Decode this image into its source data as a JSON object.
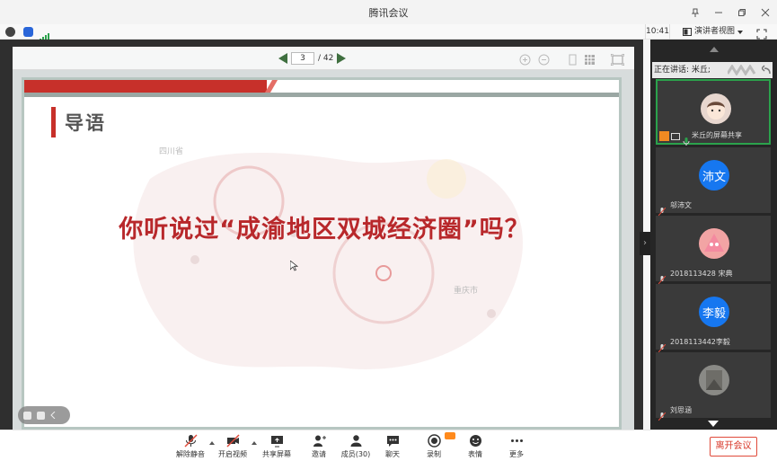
{
  "window": {
    "title": "腾讯会议"
  },
  "statusbar": {
    "time": "10:41",
    "view_mode": "演讲者视图"
  },
  "pdf": {
    "current_page": "3",
    "total_pages": "/ 42"
  },
  "slide": {
    "heading": "导语",
    "question": "你听说过“成渝地区双城经济圈”吗？",
    "map_labels": {
      "sichuan": "四川省",
      "chongqing": "重庆市"
    }
  },
  "panel": {
    "speaking_label": "正在讲话: 米丘;",
    "participants": [
      {
        "name": "米丘的屏幕共享",
        "avatar_text": "",
        "avatar_color": "#e8d7cf"
      },
      {
        "name": "邬沛文",
        "avatar_text": "沛文",
        "avatar_color": "#1677f0"
      },
      {
        "name": "2018113428 宋典",
        "avatar_text": "",
        "avatar_color": "#f2a4a4"
      },
      {
        "name": "2018113442李毅",
        "avatar_text": "李毅",
        "avatar_color": "#1677f0"
      },
      {
        "name": "刘思涵",
        "avatar_text": "",
        "avatar_color": "#8a8a86"
      }
    ]
  },
  "toolbar": {
    "buttons": [
      {
        "label": "解除静音",
        "icon": "mic-muted-icon"
      },
      {
        "label": "开启视频",
        "icon": "camera-off-icon"
      },
      {
        "label": "共享屏幕",
        "icon": "share-screen-icon"
      },
      {
        "label": "邀请",
        "icon": "invite-icon"
      },
      {
        "label": "成员(30)",
        "icon": "members-icon"
      },
      {
        "label": "聊天",
        "icon": "chat-icon"
      },
      {
        "label": "录制",
        "icon": "record-icon"
      },
      {
        "label": "表情",
        "icon": "emoji-icon"
      },
      {
        "label": "更多",
        "icon": "more-icon"
      }
    ],
    "leave_label": "离开会议"
  },
  "colors": {
    "accent_red": "#c7302a",
    "active_green": "#2ba24c",
    "brand_blue": "#1677f0"
  }
}
